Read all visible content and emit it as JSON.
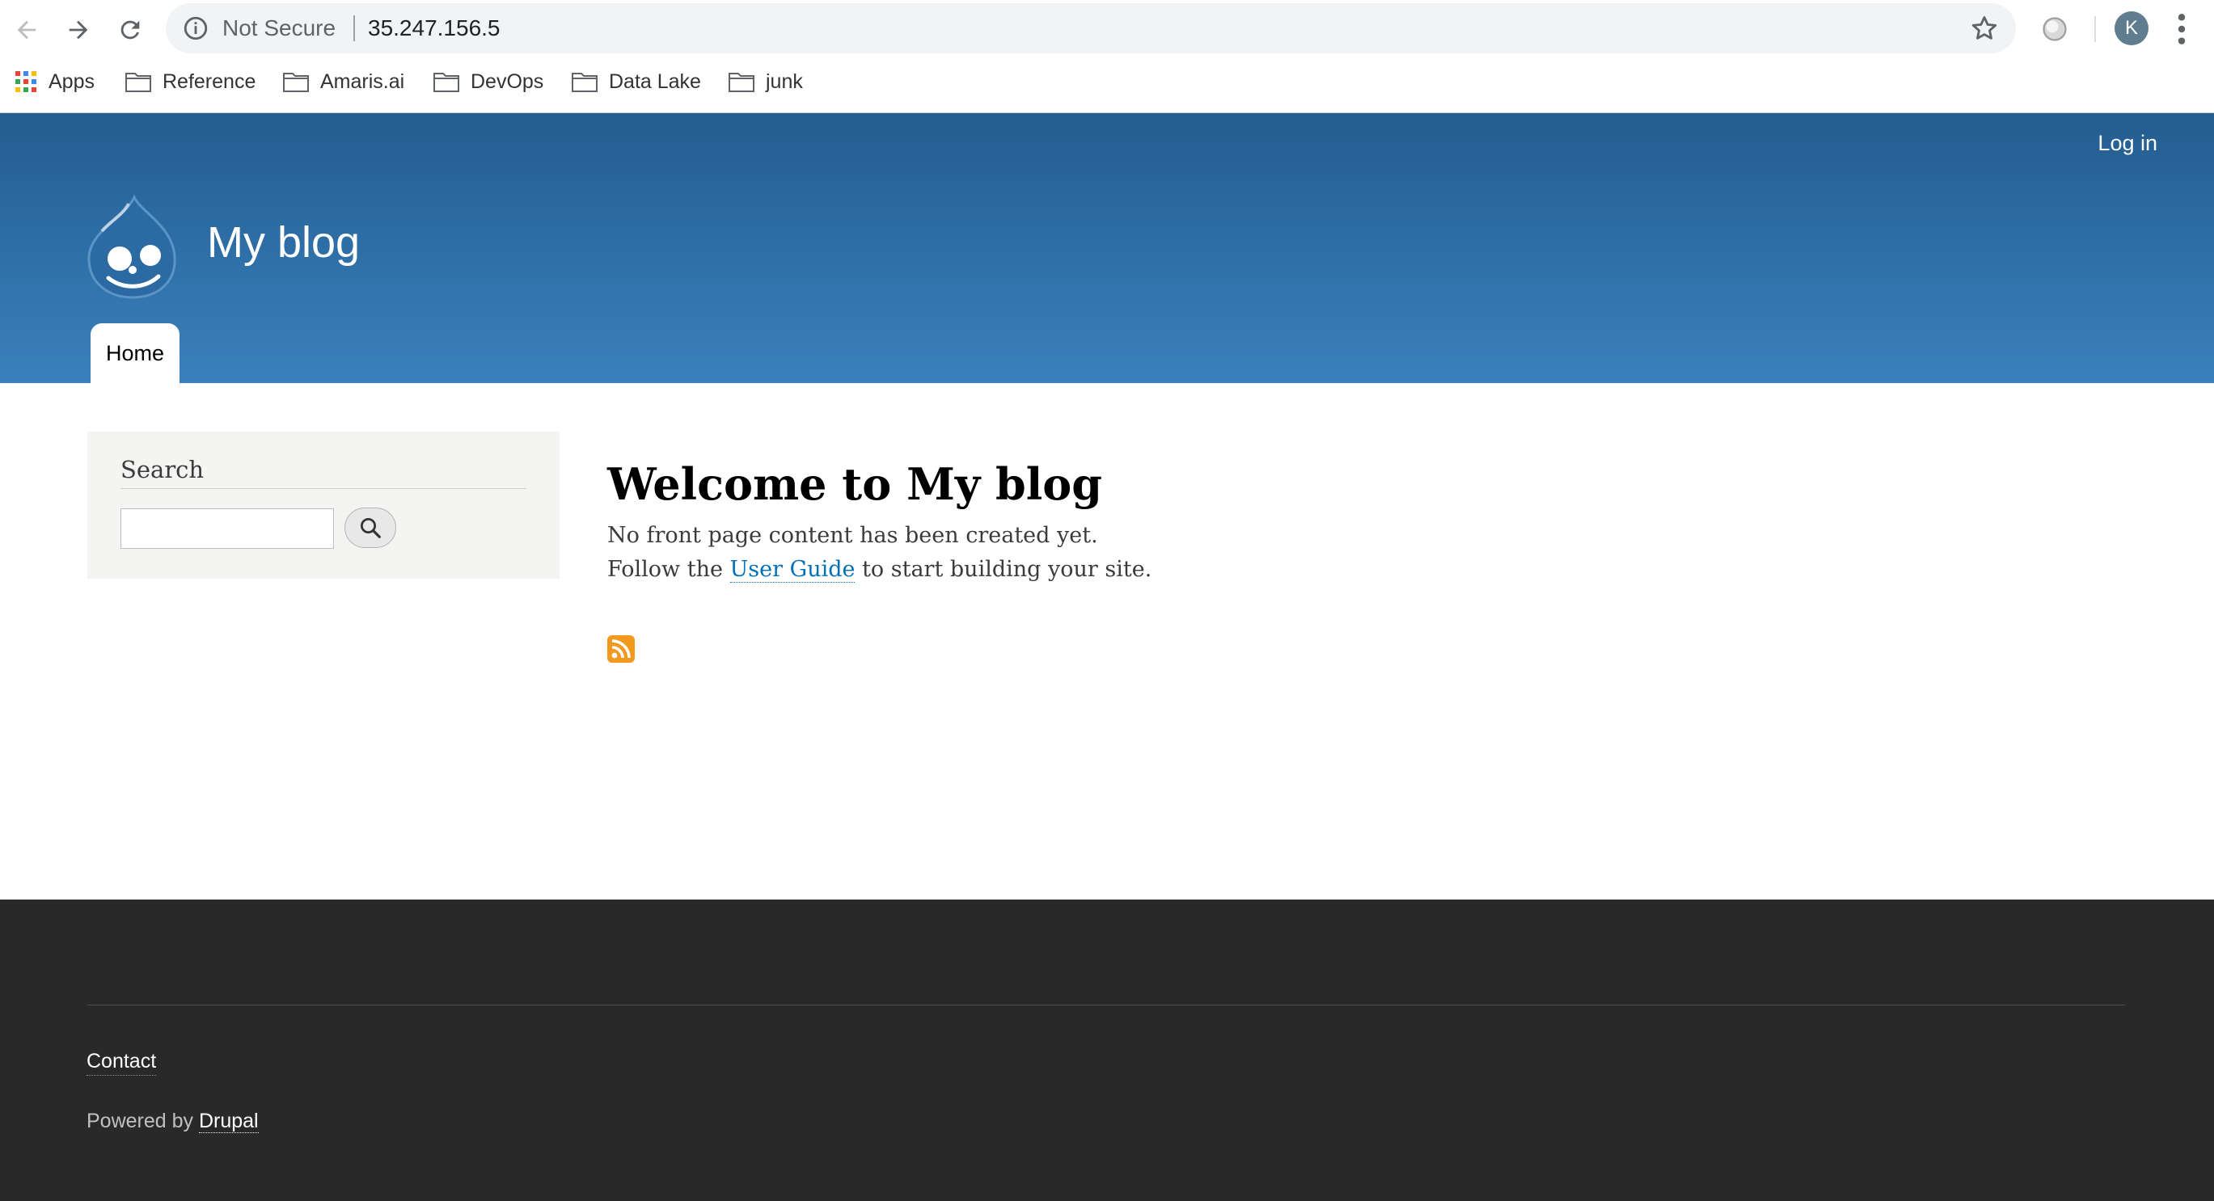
{
  "browser": {
    "address_security": "Not Secure",
    "address_url": "35.247.156.5",
    "profile_initial": "K",
    "bookmarks": [
      "Apps",
      "Reference",
      "Amaris.ai",
      "DevOps",
      "Data Lake",
      "junk"
    ]
  },
  "site": {
    "login_label": "Log in",
    "name": "My blog",
    "nav": {
      "home_label": "Home"
    }
  },
  "sidebar": {
    "search_title": "Search",
    "search_value": ""
  },
  "main": {
    "title": "Welcome to My blog",
    "line1": "No front page content has been created yet.",
    "line2_prefix": "Follow the ",
    "line2_link": "User Guide",
    "line2_suffix": " to start building your site.",
    "feed_icon": "rss-icon"
  },
  "footer": {
    "contact_label": "Contact",
    "powered_prefix": "Powered by ",
    "powered_link": "Drupal"
  },
  "colors": {
    "header_top": "#235c8f",
    "header_bottom": "#3a81bd",
    "link": "#0071b8",
    "footer_bg": "#292929",
    "rss": "#f39a1e"
  }
}
